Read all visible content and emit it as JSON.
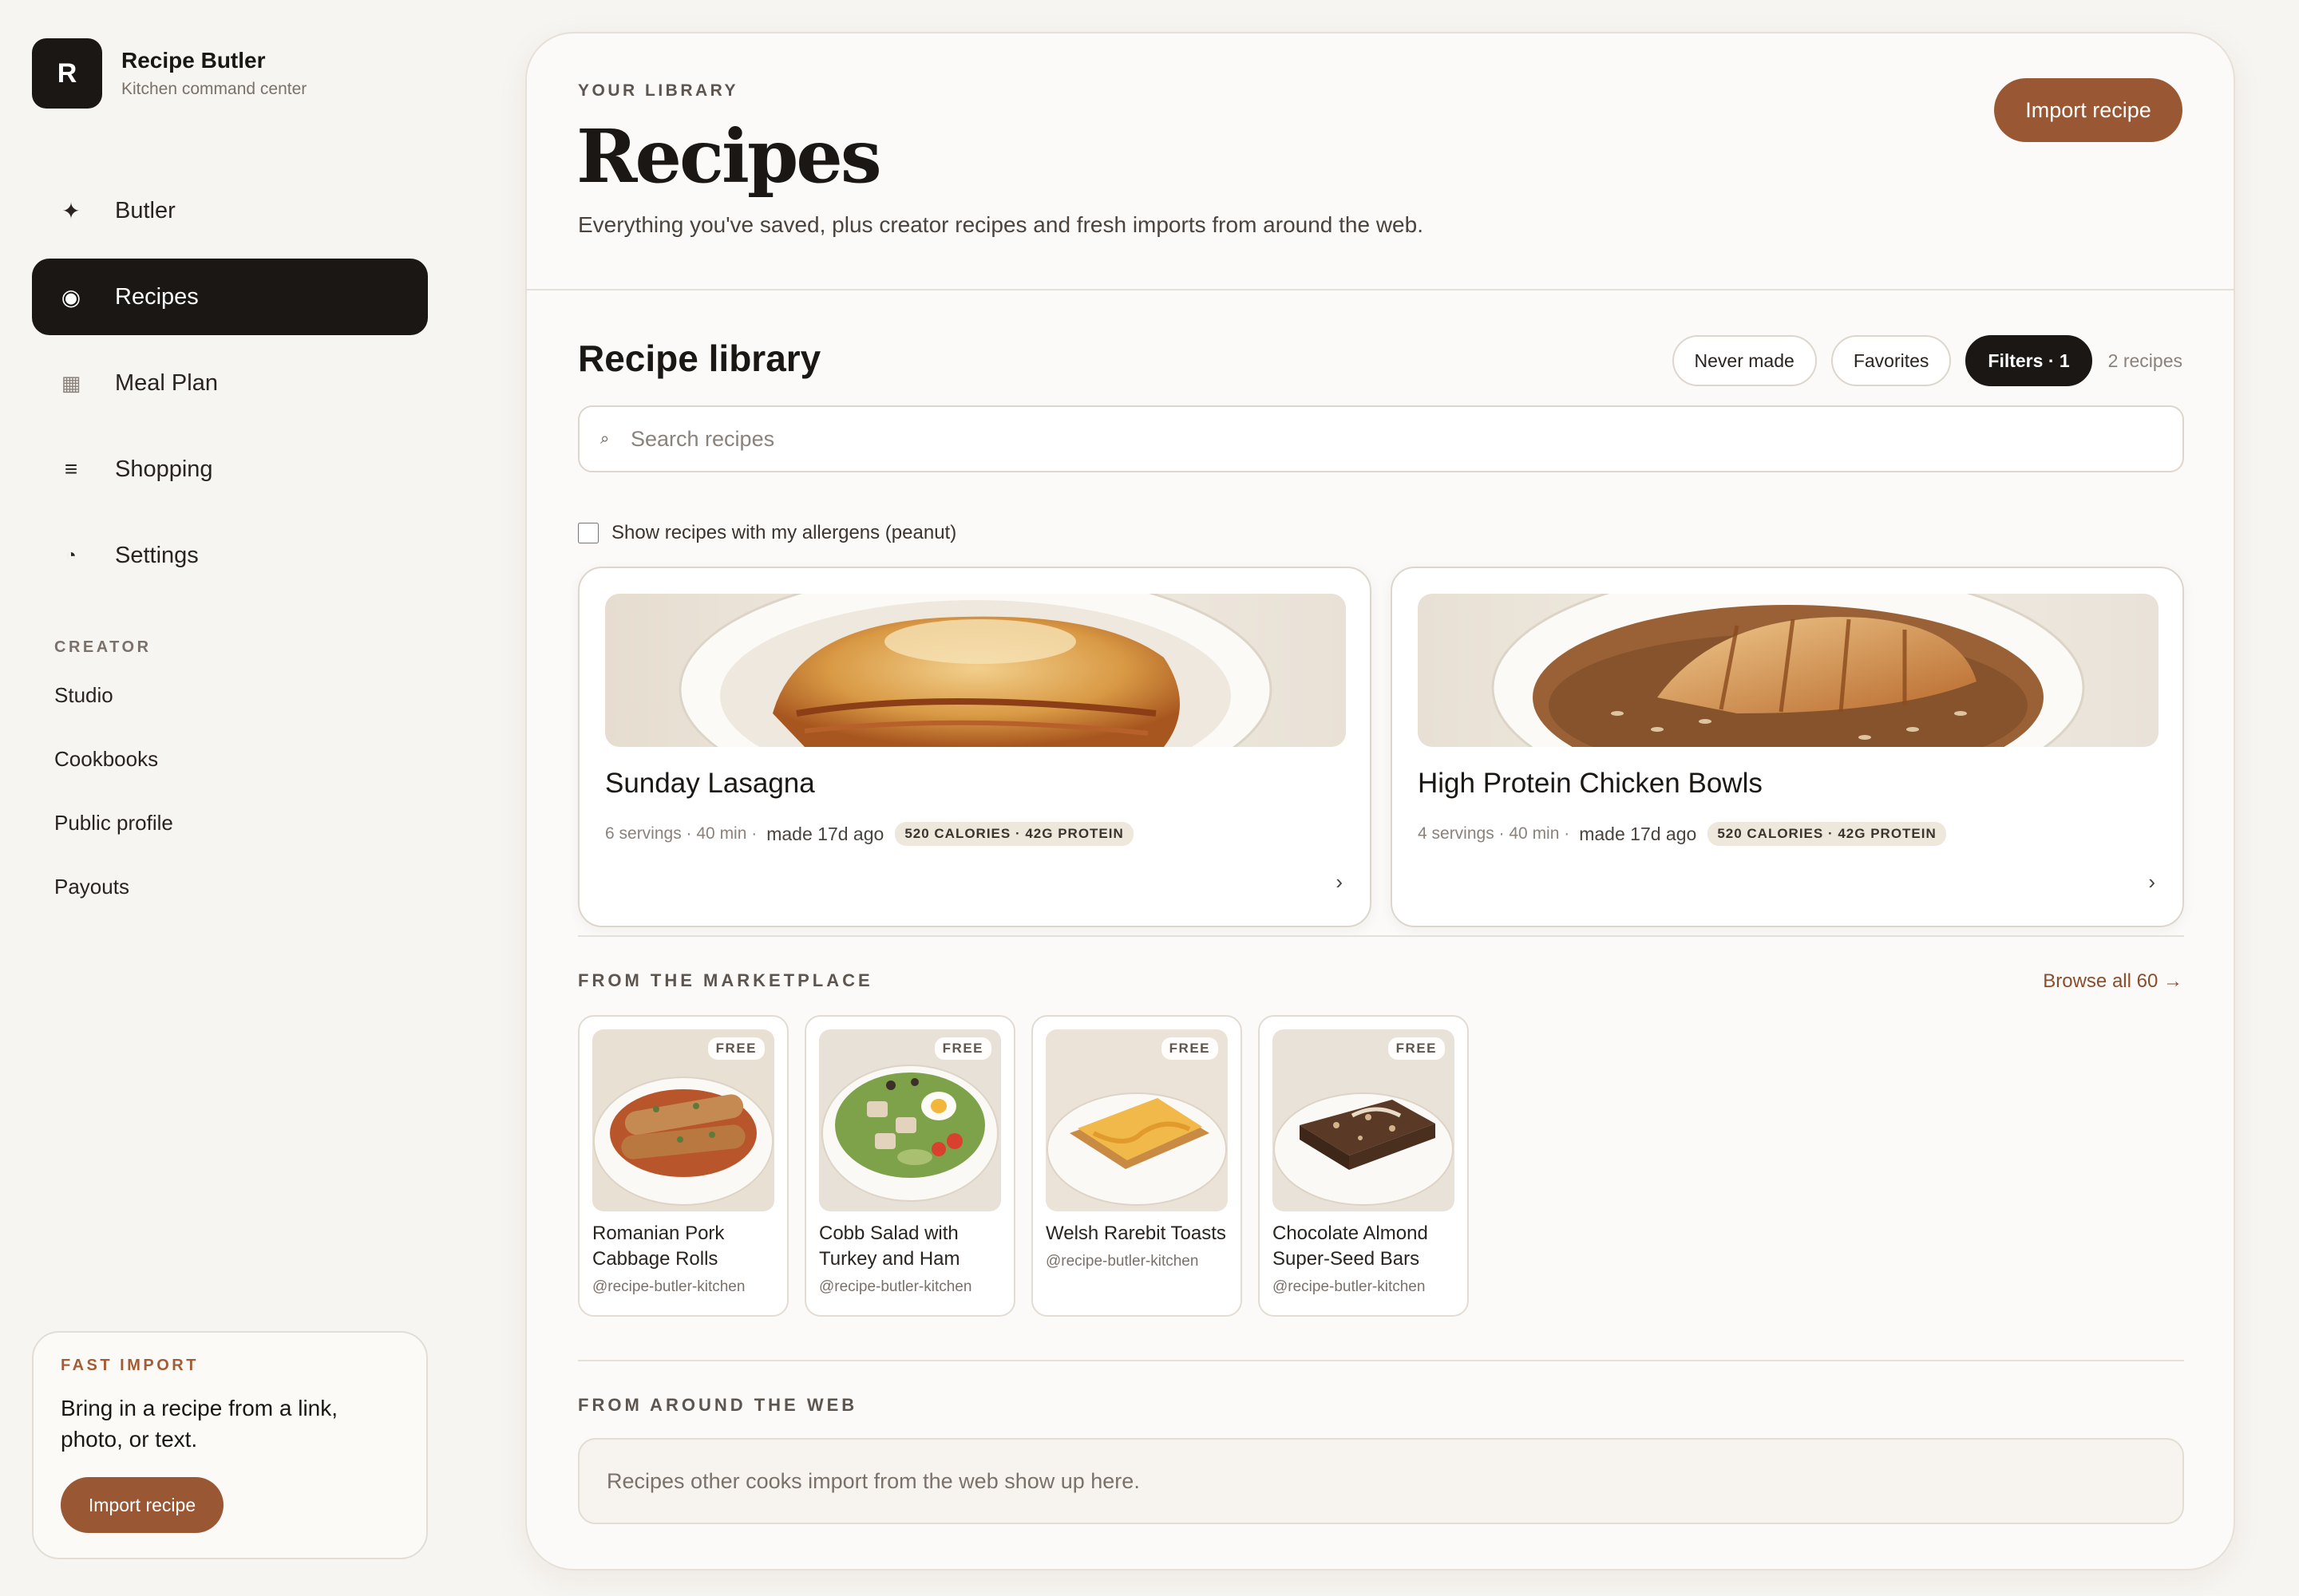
{
  "brand": {
    "logo_letter": "R",
    "name": "Recipe Butler",
    "tagline": "Kitchen command center"
  },
  "nav": [
    {
      "label": "Butler",
      "icon": "sparkle-icon",
      "glyph": "✦",
      "active": false
    },
    {
      "label": "Recipes",
      "icon": "recipes-icon",
      "glyph": "◉",
      "active": true
    },
    {
      "label": "Meal Plan",
      "icon": "calendar-icon",
      "glyph": "▦",
      "active": false
    },
    {
      "label": "Shopping",
      "icon": "list-icon",
      "glyph": "≡",
      "active": false
    },
    {
      "label": "Settings",
      "icon": "settings-icon",
      "glyph": "◔",
      "active": false
    }
  ],
  "creator": {
    "heading": "CREATOR",
    "items": [
      "Studio",
      "Cookbooks",
      "Public profile",
      "Payouts"
    ]
  },
  "fast_import": {
    "label": "FAST IMPORT",
    "text": "Bring in a recipe from a link, photo, or text.",
    "button": "Import recipe"
  },
  "header": {
    "eyebrow": "YOUR LIBRARY",
    "title": "Recipes",
    "subtitle": "Everything you've saved, plus creator recipes and fresh imports from around the web.",
    "import_button": "Import recipe"
  },
  "library": {
    "title": "Recipe library",
    "filters": {
      "never_made": "Never made",
      "favorites": "Favorites",
      "filters": "Filters · 1"
    },
    "count": "2 recipes",
    "search_placeholder": "Search recipes",
    "search_value": "",
    "allergen_label": "Show recipes with my allergens (peanut)",
    "allergen_checked": false,
    "recipes": [
      {
        "name": "Sunday Lasagna",
        "meta": "6 servings · 40 min ·",
        "made": "made 17d ago",
        "nutrition": "520 CALORIES · 42G PROTEIN",
        "image_icon": "lasagna-image"
      },
      {
        "name": "High Protein Chicken Bowls",
        "meta": "4 servings · 40 min ·",
        "made": "made 17d ago",
        "nutrition": "520 CALORIES · 42G PROTEIN",
        "image_icon": "chicken-rice-image"
      }
    ],
    "chevron": "›"
  },
  "marketplace": {
    "heading": "FROM THE MARKETPLACE",
    "browse": "Browse all 60 →",
    "items": [
      {
        "title": "Romanian Pork Cabbage Rolls",
        "handle": "@recipe-butler-kitchen",
        "badge": "FREE",
        "image_icon": "cabbage-rolls-image"
      },
      {
        "title": "Cobb Salad with Turkey and Ham",
        "handle": "@recipe-butler-kitchen",
        "badge": "FREE",
        "image_icon": "cobb-salad-image"
      },
      {
        "title": "Welsh Rarebit Toasts",
        "handle": "@recipe-butler-kitchen",
        "badge": "FREE",
        "image_icon": "rarebit-toast-image"
      },
      {
        "title": "Chocolate Almond Super-Seed Bars",
        "handle": "@recipe-butler-kitchen",
        "badge": "FREE",
        "image_icon": "chocolate-bar-image"
      }
    ]
  },
  "web": {
    "heading": "FROM AROUND THE WEB",
    "empty_text": "Recipes other cooks import from the web show up here."
  },
  "colors": {
    "accent": "#9a5734",
    "ink": "#1b1714",
    "background": "#f7f5f1",
    "panel": "#fbfaf8",
    "muted": "#7a716a"
  }
}
